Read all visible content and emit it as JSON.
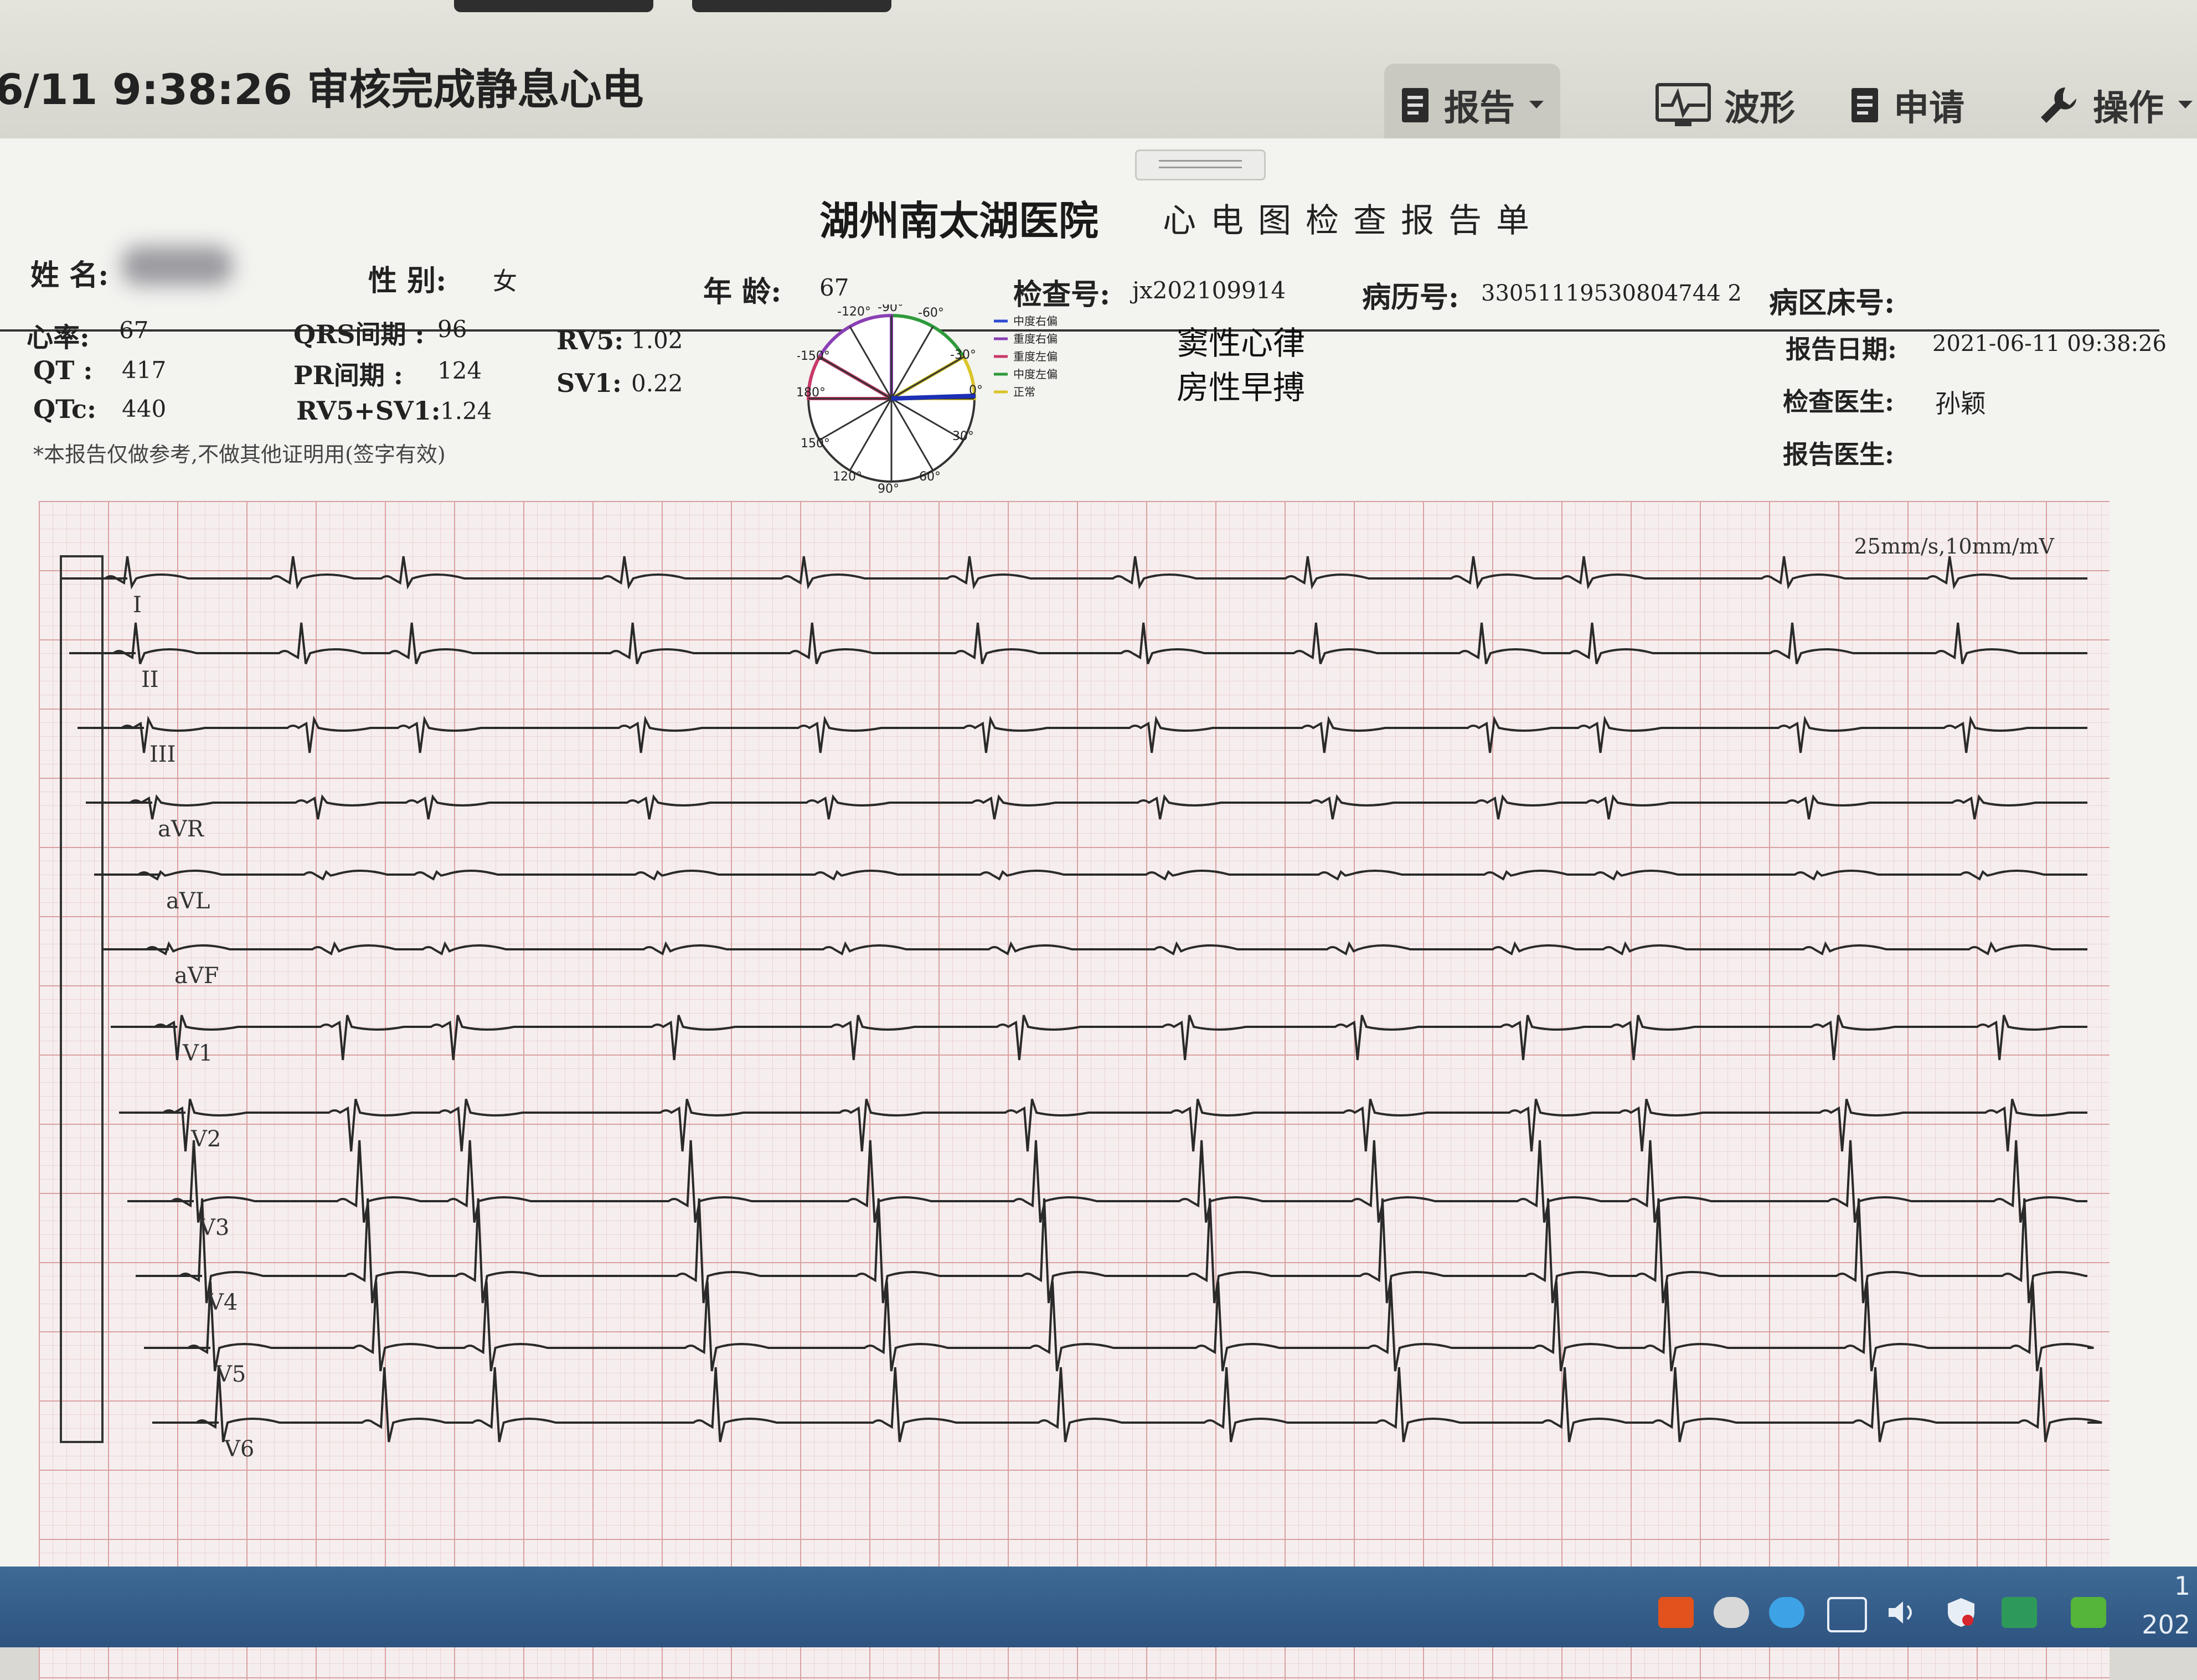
{
  "window": {
    "record_title": "6/11 9:38:26 审核完成静息心电",
    "toolbar": [
      {
        "label": "报告",
        "icon": "report-icon",
        "has_dropdown": true
      },
      {
        "label": "波形",
        "icon": "waveform-icon"
      },
      {
        "label": "申请",
        "icon": "request-icon"
      },
      {
        "label": "操作",
        "icon": "wrench-icon",
        "has_dropdown": true
      }
    ]
  },
  "report": {
    "hospital": "湖州南太湖医院",
    "form_title": "心电图检查报告单",
    "patient": {
      "name_label": "姓 名:",
      "sex_label": "性 别:",
      "sex": "女",
      "age_label": "年 龄:",
      "age": "67",
      "exam_no_label": "检查号:",
      "exam_no": "jx202109914",
      "record_no_label": "病历号:",
      "record_no": "33051119530804744 2",
      "ward_bed_label": "病区床号:"
    },
    "measurements": {
      "hr_label": "心率:",
      "hr": "67",
      "qt_label": "QT :",
      "qt": "417",
      "qtc_label": "QTc:",
      "qtc": "440",
      "qrs_label": "QRS间期 :",
      "qrs": "96",
      "pr_label": "PR间期 :",
      "pr": "124",
      "rv5sv1_label": "RV5+SV1:",
      "rv5sv1": "1.24",
      "rv5_label": "RV5:",
      "rv5": "1.02",
      "sv1_label": "SV1:",
      "sv1": "0.22"
    },
    "disclaimer": "*本报告仅做参考,不做其他证明用(签字有效)",
    "axis": {
      "ticks": [
        "-120°",
        "-90°",
        "-60°",
        "-150°",
        "-30°",
        "180°",
        "0°",
        "150°",
        "30°",
        "120°",
        "90°",
        "60°"
      ],
      "legend": [
        "中度右偏",
        "重度右偏",
        "重度左偏",
        "中度左偏",
        "正常"
      ],
      "value": "2°",
      "status": "正常"
    },
    "diagnosis": [
      "窦性心律",
      "房性早搏"
    ],
    "report_date_label": "报告日期:",
    "report_date": "2021-06-11 09:38:26",
    "exam_doctor_label": "检查医生:",
    "exam_doctor": "孙颖",
    "report_doctor_label": "报告医生:"
  },
  "ecg": {
    "speed_gain": "25mm/s,10mm/mV",
    "leads": [
      "I",
      "II",
      "III",
      "aVR",
      "aVL",
      "aVF",
      "V1",
      "V2",
      "V3",
      "V4",
      "V5",
      "V6"
    ]
  },
  "taskbar": {
    "clock_line1": "1",
    "clock_line2": "202"
  }
}
